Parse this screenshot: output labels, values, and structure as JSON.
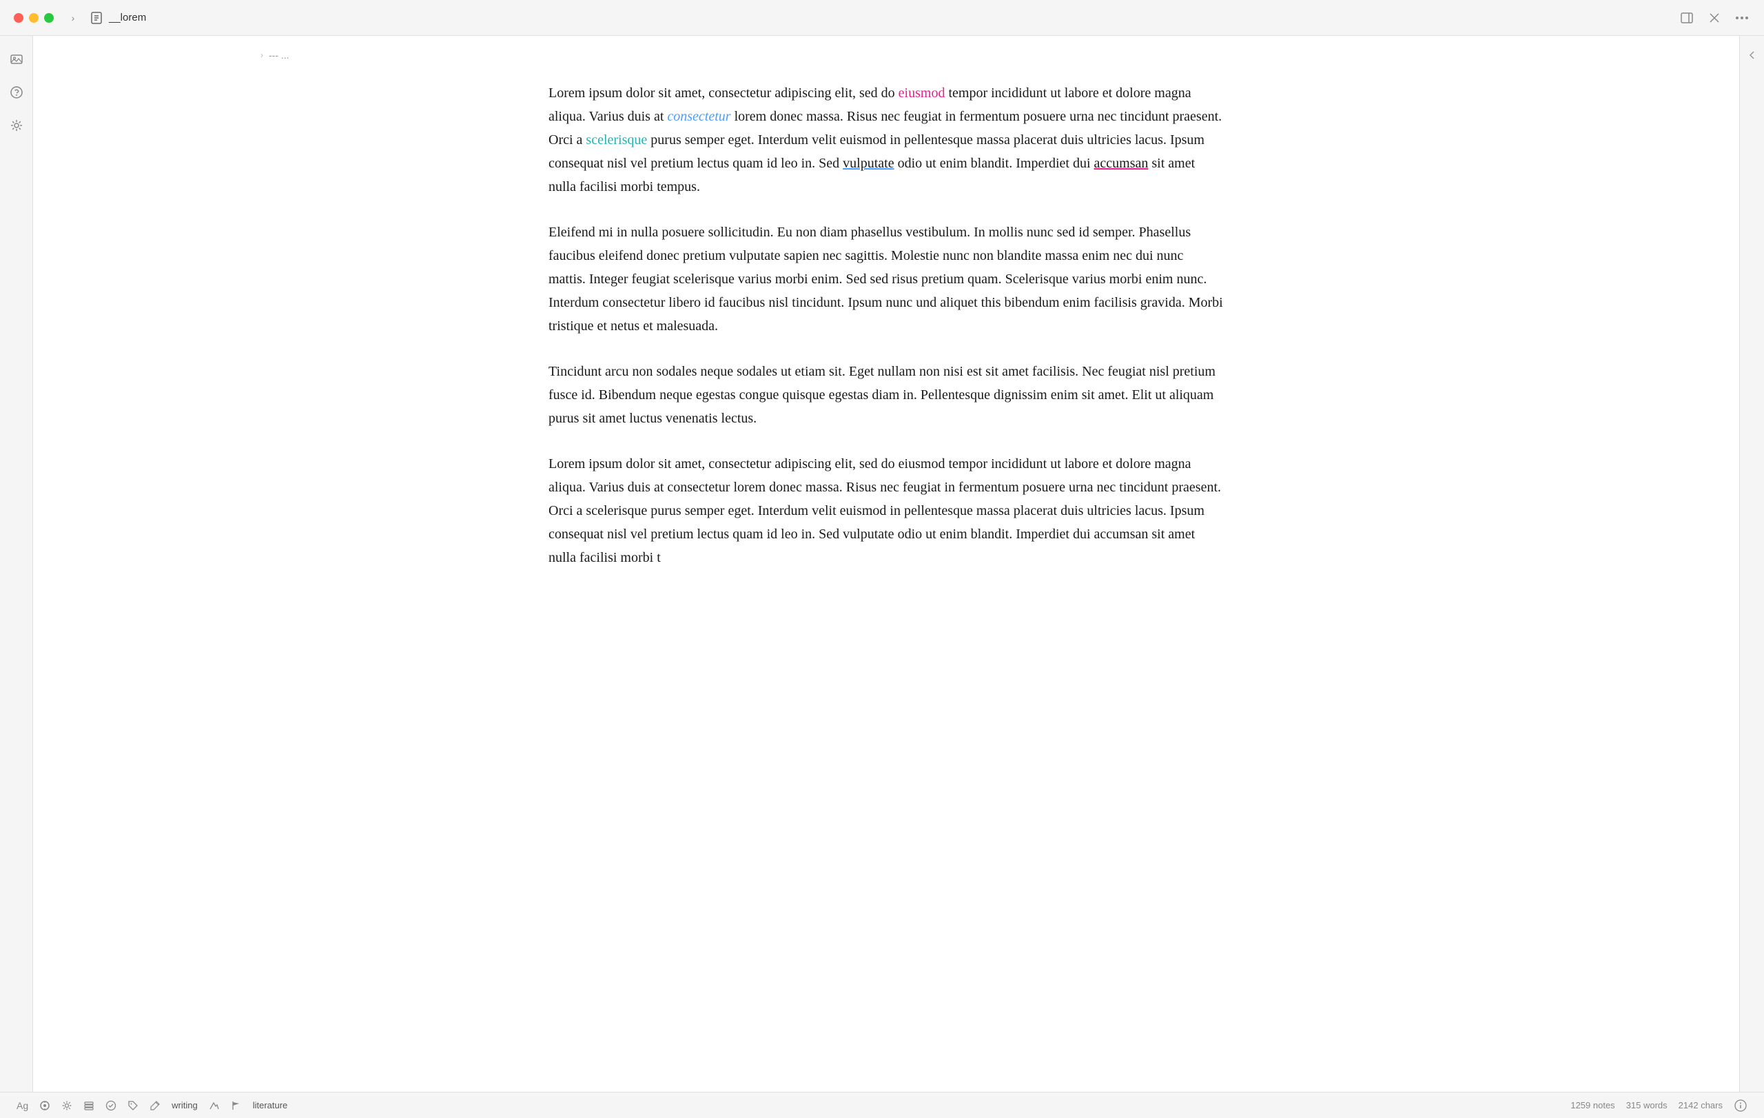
{
  "window": {
    "title": "__lorem"
  },
  "titlebar": {
    "traffic": {
      "close": "close",
      "minimize": "minimize",
      "maximize": "maximize"
    },
    "sidebar_toggle": "›",
    "doc_title": "__lorem",
    "actions": {
      "panel": "⬜",
      "close": "✕",
      "more": "•••"
    }
  },
  "breadcrumb": {
    "chevron": "›",
    "separator": "---",
    "dots": "..."
  },
  "content": {
    "paragraph1": {
      "before_highlight1": "Lorem ipsum dolor sit amet, consectetur adipiscing elit, sed do ",
      "highlight1": "eiusmod",
      "between1": " tempor incididunt ut labore et dolore magna aliqua. Varius duis at ",
      "highlight2": "consectetur",
      "between2": " lorem donec massa. Risus nec feugiat in fermentum posuere urna nec tincidunt praesent. Orci a ",
      "highlight3": "scelerisque",
      "between3": " purus semper eget. Interdum velit euismod in pellentesque massa placerat duis ultricies lacus. Ipsum consequat nisl vel pretium lectus quam id leo in. Sed ",
      "highlight4": "vulputate",
      "between4": " odio ut enim blandit. Imperdiet dui ",
      "highlight5": "accumsan",
      "after": " sit amet nulla facilisi morbi tempus."
    },
    "paragraph2": "Eleifend mi in nulla posuere sollicitudin. Eu non diam phasellus vestibulum. In mollis nunc sed id semper. Phasellus faucibus eleifend donec pretium vulputate sapien nec sagittis. Molestie nunc non blandite massa enim nec dui nunc mattis. Integer feugiat scelerisque varius morbi enim. Sed sed risus pretium quam. Scelerisque varius morbi enim nunc. Interdum consectetur libero id faucibus nisl tincidunt. Ipsum nunc und aliquet this bibendum enim facilisis gravida. Morbi tristique et netus et malesuada.",
    "paragraph3": "Tincidunt arcu non sodales neque sodales ut etiam sit. Eget nullam non nisi est sit amet facilisis. Nec feugiat nisl pretium fusce id. Bibendum neque egestas congue quisque egestas diam in. Pellentesque dignissim enim sit amet. Elit ut aliquam purus sit amet luctus venenatis lectus.",
    "paragraph4": {
      "text": "Lorem ipsum dolor sit amet, consectetur adipiscing elit, sed do eiusmod tempor incididunt ut labore et dolore magna aliqua. Varius duis at consectetur lorem donec massa. Risus nec feugiat in fermentum posuere urna nec tincidunt praesent. Orci a scelerisque purus semper eget. Interdum velit euismod in pellentesque massa placerat duis ultricies lacus. Ipsum consequat nisl vel pretium lectus quam id leo in. Sed vulputate odio ut enim blandit. Imperdiet dui accumsan sit amet nulla facilisi morbi t"
    }
  },
  "sidebar": {
    "icons": [
      "image",
      "help",
      "settings"
    ]
  },
  "statusbar": {
    "ag_label": "Ag",
    "icons": [
      "target",
      "gear",
      "stack",
      "circle-check",
      "tag",
      "pencil"
    ],
    "writing_label": "writing",
    "literature_label": "literature",
    "notes_count": "1259 notes",
    "words_count": "315 words",
    "chars_count": "2142 chars",
    "right_icon": "ℹ"
  }
}
